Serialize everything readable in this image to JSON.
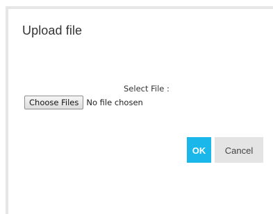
{
  "dialog": {
    "title": "Upload file"
  },
  "file_input": {
    "label": "Select File :",
    "button_label": "Choose Files",
    "status_text": "No file chosen"
  },
  "actions": {
    "ok_label": "OK",
    "cancel_label": "Cancel"
  },
  "colors": {
    "ok_button": "#1ab7ea",
    "cancel_button": "#e4e4e4",
    "frame_border": "#e6e6e6"
  }
}
